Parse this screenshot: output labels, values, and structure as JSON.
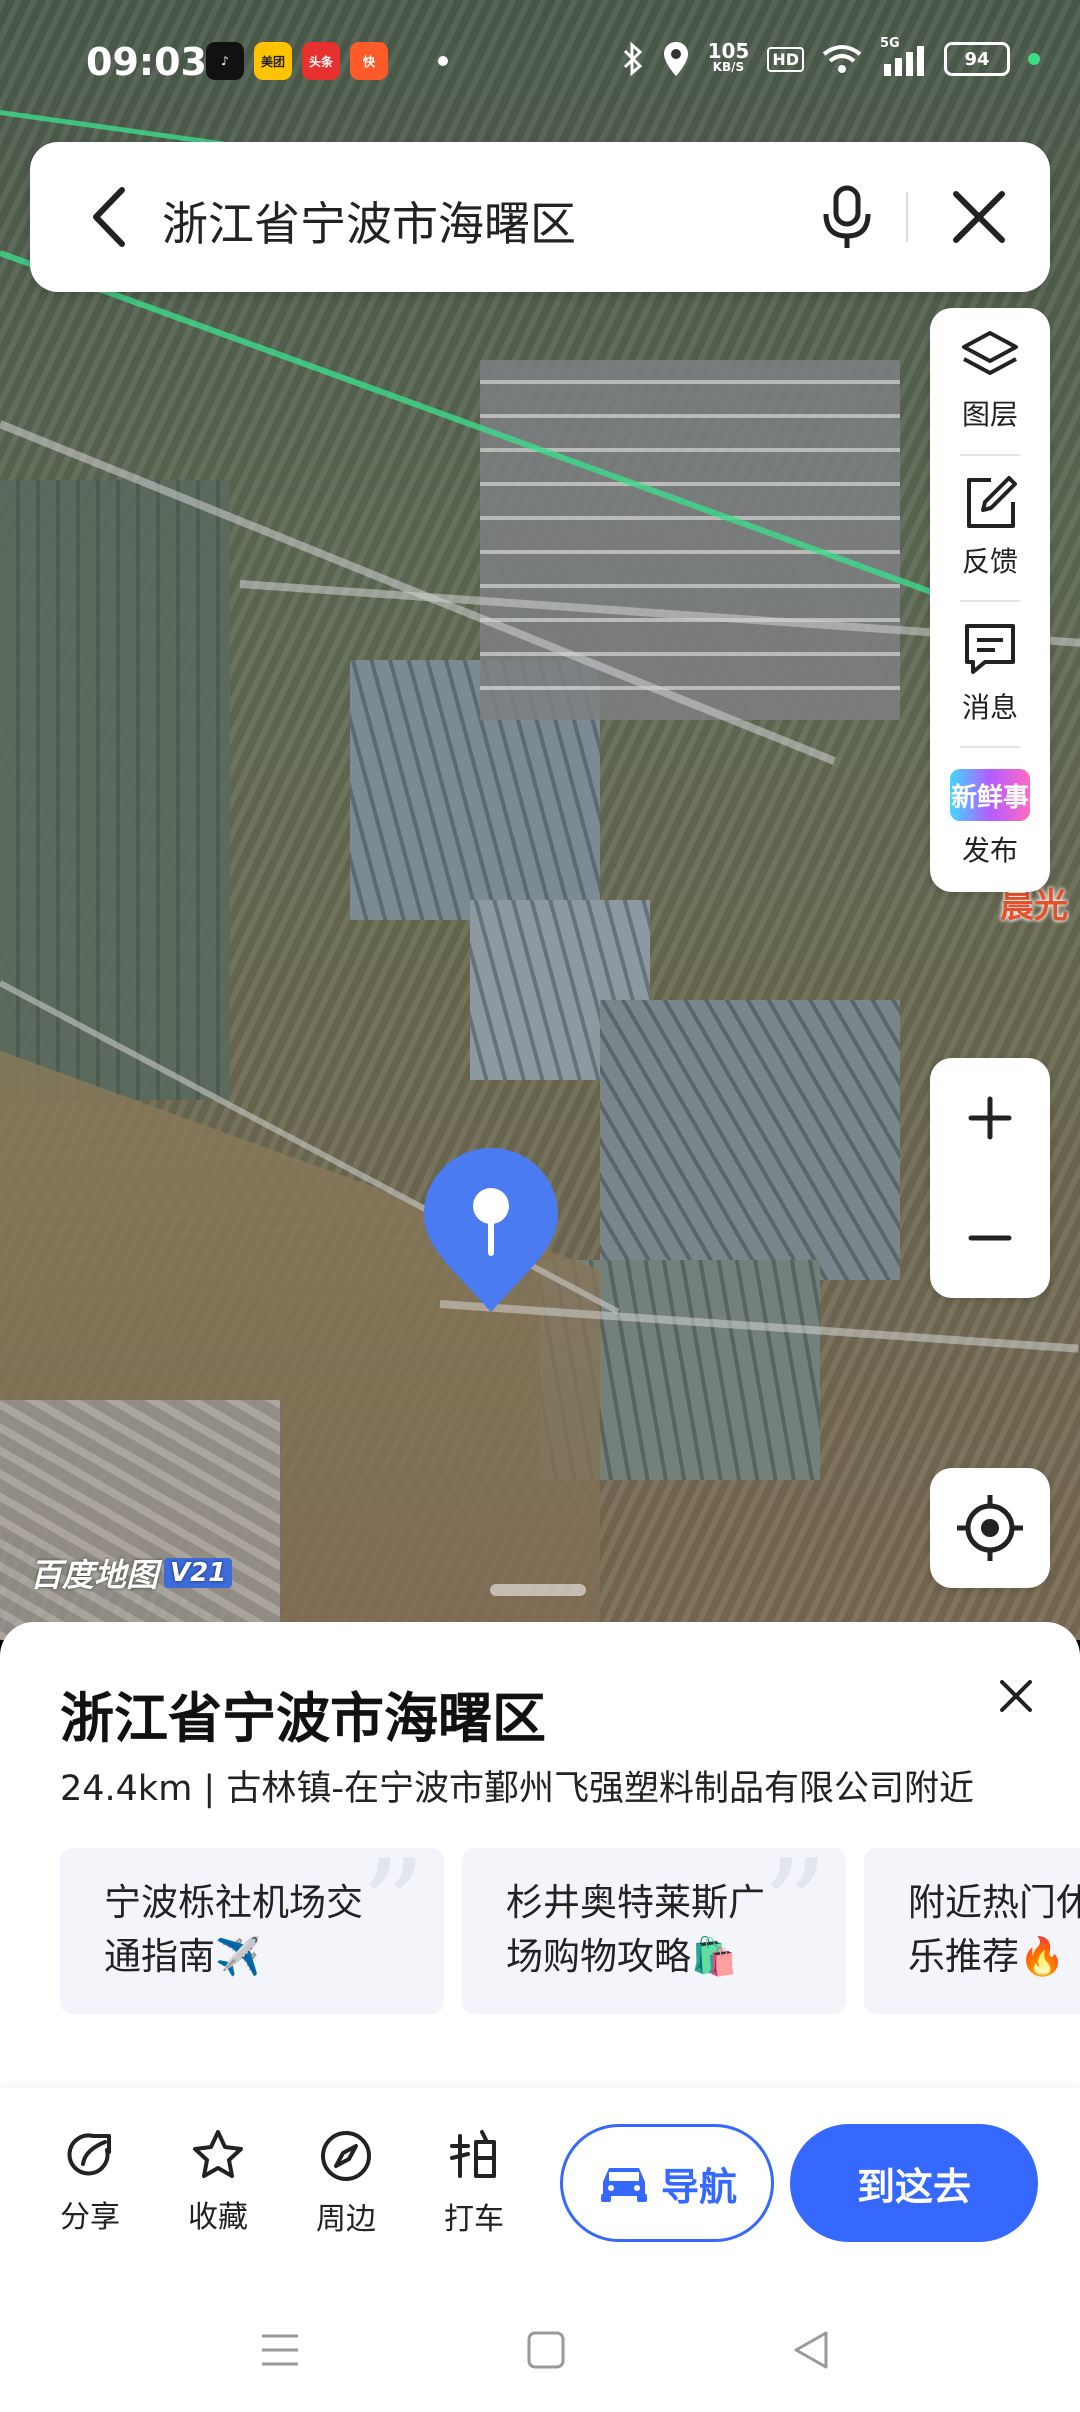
{
  "status_bar": {
    "time": "09:03",
    "apps": [
      {
        "name": "douyin",
        "label": "♪",
        "color": "#111111"
      },
      {
        "name": "meituan",
        "label": "美团",
        "color": "#ffc300"
      },
      {
        "name": "toutiao",
        "label": "头条",
        "color": "#e8312f"
      },
      {
        "name": "kuaishou",
        "label": "快",
        "color": "#ff5a2a"
      }
    ],
    "netspeed_value": "105",
    "netspeed_unit": "KB/S",
    "hd_label": "HD",
    "signal_label": "5G",
    "battery": "94"
  },
  "search": {
    "query": "浙江省宁波市海曙区"
  },
  "tools": {
    "layers_label": "图层",
    "feedback_label": "反馈",
    "messages_label": "消息",
    "publish_label": "发布",
    "publish_badge": "新鲜事"
  },
  "map": {
    "poi_label": "晨光",
    "watermark": "百度地图",
    "watermark_version": "V21"
  },
  "sheet": {
    "title": "浙江省宁波市海曙区",
    "subtitle": "24.4km | 古林镇-在宁波市鄞州飞强塑料制品有限公司附近",
    "cards": [
      {
        "line1": "宁波栎社机场交",
        "line2": "通指南✈️"
      },
      {
        "line1": "杉井奥特莱斯广",
        "line2": "场购物攻略🛍️"
      },
      {
        "line1": "附近热门休",
        "line2": "乐推荐🔥"
      }
    ]
  },
  "actions": {
    "share": "分享",
    "favorite": "收藏",
    "nearby": "周边",
    "taxi": "打车",
    "navigate": "导航",
    "go_there": "到这去"
  },
  "colors": {
    "accent": "#3468ff",
    "pin": "#4a7bf0"
  }
}
